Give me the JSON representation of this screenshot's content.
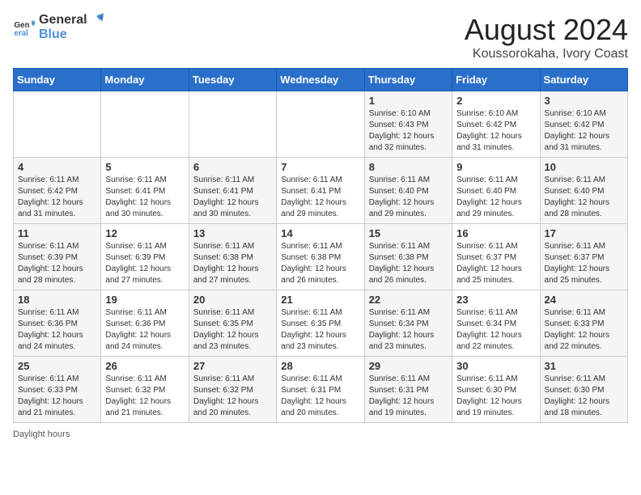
{
  "header": {
    "logo_line1": "General",
    "logo_line2": "Blue",
    "title": "August 2024",
    "subtitle": "Koussorokaha, Ivory Coast"
  },
  "days_of_week": [
    "Sunday",
    "Monday",
    "Tuesday",
    "Wednesday",
    "Thursday",
    "Friday",
    "Saturday"
  ],
  "weeks": [
    [
      {
        "day": "",
        "text": ""
      },
      {
        "day": "",
        "text": ""
      },
      {
        "day": "",
        "text": ""
      },
      {
        "day": "",
        "text": ""
      },
      {
        "day": "1",
        "text": "Sunrise: 6:10 AM\nSunset: 6:43 PM\nDaylight: 12 hours and 32 minutes."
      },
      {
        "day": "2",
        "text": "Sunrise: 6:10 AM\nSunset: 6:42 PM\nDaylight: 12 hours and 31 minutes."
      },
      {
        "day": "3",
        "text": "Sunrise: 6:10 AM\nSunset: 6:42 PM\nDaylight: 12 hours and 31 minutes."
      }
    ],
    [
      {
        "day": "4",
        "text": "Sunrise: 6:11 AM\nSunset: 6:42 PM\nDaylight: 12 hours and 31 minutes."
      },
      {
        "day": "5",
        "text": "Sunrise: 6:11 AM\nSunset: 6:41 PM\nDaylight: 12 hours and 30 minutes."
      },
      {
        "day": "6",
        "text": "Sunrise: 6:11 AM\nSunset: 6:41 PM\nDaylight: 12 hours and 30 minutes."
      },
      {
        "day": "7",
        "text": "Sunrise: 6:11 AM\nSunset: 6:41 PM\nDaylight: 12 hours and 29 minutes."
      },
      {
        "day": "8",
        "text": "Sunrise: 6:11 AM\nSunset: 6:40 PM\nDaylight: 12 hours and 29 minutes."
      },
      {
        "day": "9",
        "text": "Sunrise: 6:11 AM\nSunset: 6:40 PM\nDaylight: 12 hours and 29 minutes."
      },
      {
        "day": "10",
        "text": "Sunrise: 6:11 AM\nSunset: 6:40 PM\nDaylight: 12 hours and 28 minutes."
      }
    ],
    [
      {
        "day": "11",
        "text": "Sunrise: 6:11 AM\nSunset: 6:39 PM\nDaylight: 12 hours and 28 minutes."
      },
      {
        "day": "12",
        "text": "Sunrise: 6:11 AM\nSunset: 6:39 PM\nDaylight: 12 hours and 27 minutes."
      },
      {
        "day": "13",
        "text": "Sunrise: 6:11 AM\nSunset: 6:38 PM\nDaylight: 12 hours and 27 minutes."
      },
      {
        "day": "14",
        "text": "Sunrise: 6:11 AM\nSunset: 6:38 PM\nDaylight: 12 hours and 26 minutes."
      },
      {
        "day": "15",
        "text": "Sunrise: 6:11 AM\nSunset: 6:38 PM\nDaylight: 12 hours and 26 minutes."
      },
      {
        "day": "16",
        "text": "Sunrise: 6:11 AM\nSunset: 6:37 PM\nDaylight: 12 hours and 25 minutes."
      },
      {
        "day": "17",
        "text": "Sunrise: 6:11 AM\nSunset: 6:37 PM\nDaylight: 12 hours and 25 minutes."
      }
    ],
    [
      {
        "day": "18",
        "text": "Sunrise: 6:11 AM\nSunset: 6:36 PM\nDaylight: 12 hours and 24 minutes."
      },
      {
        "day": "19",
        "text": "Sunrise: 6:11 AM\nSunset: 6:36 PM\nDaylight: 12 hours and 24 minutes."
      },
      {
        "day": "20",
        "text": "Sunrise: 6:11 AM\nSunset: 6:35 PM\nDaylight: 12 hours and 23 minutes."
      },
      {
        "day": "21",
        "text": "Sunrise: 6:11 AM\nSunset: 6:35 PM\nDaylight: 12 hours and 23 minutes."
      },
      {
        "day": "22",
        "text": "Sunrise: 6:11 AM\nSunset: 6:34 PM\nDaylight: 12 hours and 23 minutes."
      },
      {
        "day": "23",
        "text": "Sunrise: 6:11 AM\nSunset: 6:34 PM\nDaylight: 12 hours and 22 minutes."
      },
      {
        "day": "24",
        "text": "Sunrise: 6:11 AM\nSunset: 6:33 PM\nDaylight: 12 hours and 22 minutes."
      }
    ],
    [
      {
        "day": "25",
        "text": "Sunrise: 6:11 AM\nSunset: 6:33 PM\nDaylight: 12 hours and 21 minutes."
      },
      {
        "day": "26",
        "text": "Sunrise: 6:11 AM\nSunset: 6:32 PM\nDaylight: 12 hours and 21 minutes."
      },
      {
        "day": "27",
        "text": "Sunrise: 6:11 AM\nSunset: 6:32 PM\nDaylight: 12 hours and 20 minutes."
      },
      {
        "day": "28",
        "text": "Sunrise: 6:11 AM\nSunset: 6:31 PM\nDaylight: 12 hours and 20 minutes."
      },
      {
        "day": "29",
        "text": "Sunrise: 6:11 AM\nSunset: 6:31 PM\nDaylight: 12 hours and 19 minutes."
      },
      {
        "day": "30",
        "text": "Sunrise: 6:11 AM\nSunset: 6:30 PM\nDaylight: 12 hours and 19 minutes."
      },
      {
        "day": "31",
        "text": "Sunrise: 6:11 AM\nSunset: 6:30 PM\nDaylight: 12 hours and 18 minutes."
      }
    ]
  ],
  "footer": {
    "text": "Daylight hours"
  }
}
